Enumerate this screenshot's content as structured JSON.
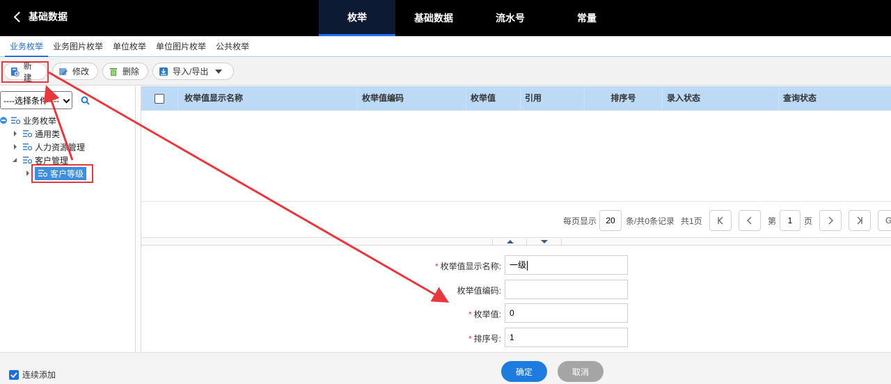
{
  "header": {
    "back_title": "基础数据",
    "nav": [
      "枚举",
      "基础数据",
      "流水号",
      "常量"
    ],
    "active_nav": "枚举"
  },
  "subtabs": [
    "业务枚举",
    "业务图片枚举",
    "单位枚举",
    "单位图片枚举",
    "公共枚举"
  ],
  "toolbar": {
    "new_label": "新建",
    "edit_label": "修改",
    "delete_label": "删除",
    "import_export_label": "导入/导出"
  },
  "tree": {
    "condition_select": "----选择条件----",
    "root": "业务枚举",
    "items": [
      "通用类",
      "人力资源管理",
      "客户管理"
    ],
    "selected_child": "客户等级"
  },
  "grid": {
    "columns": [
      "枚举值显示名称",
      "枚举值编码",
      "枚举值",
      "引用",
      "排序号",
      "录入状态",
      "查询状态"
    ]
  },
  "pager": {
    "per_page_label": "每页显示",
    "per_page_value": "20",
    "records_label": "条/共0条记录",
    "pages_label": "共1页",
    "page_prefix": "第",
    "page_value": "1",
    "page_suffix": "页",
    "go_label": "G"
  },
  "form": {
    "name_label": "枚举值显示名称:",
    "name_value": "一级",
    "code_label": "枚举值编码:",
    "code_value": "",
    "value_label": "枚举值:",
    "value_value": "0",
    "order_label": "排序号:",
    "order_value": "1",
    "required_mark": "*"
  },
  "footer": {
    "continuous_add_label": "连续添加",
    "confirm_label": "确定",
    "cancel_label": "取消"
  },
  "colors": {
    "accent": "#1e7cdf",
    "annotation_red": "#e8383d",
    "grid_header": "#bcd9f6"
  }
}
